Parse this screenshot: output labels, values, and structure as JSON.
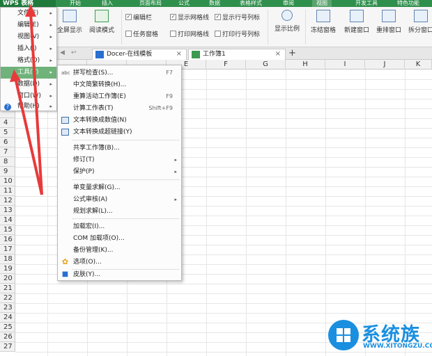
{
  "app": {
    "logo_label": "WPS 表格",
    "tabs": [
      "开始",
      "插入",
      "页面布局",
      "公式",
      "数据",
      "表格样式",
      "审阅",
      "视图",
      "开发工具",
      "特色功能"
    ],
    "active_tab": "视图"
  },
  "ribbon": {
    "fullscreen": "全屏显示",
    "reading_mode": "阅读模式",
    "check_edit_bar": "编辑栏",
    "check_task_pane": "任务窗格",
    "check_show_grid": "显示网格线",
    "check_print_grid": "打印网格线",
    "check_show_headers": "显示行号列标",
    "check_print_headers": "打印行号列标",
    "zoom": "显示比例",
    "freeze": "冻结窗格",
    "new_window": "新建窗口",
    "arrange": "重排窗口",
    "split": "拆分窗口"
  },
  "tabs_bar": {
    "nav_back": "◀",
    "nav_forward": "↩",
    "docer_tab": "Docer-在线模板",
    "workbook_tab": "工作簿1",
    "close": "×",
    "new": "+"
  },
  "grid": {
    "columns": [
      "E",
      "F",
      "G",
      "H",
      "I",
      "J",
      "K"
    ],
    "rows": [
      "4",
      "5",
      "6",
      "7",
      "8",
      "9",
      "10",
      "11",
      "12",
      "13",
      "14",
      "15",
      "16",
      "17",
      "18",
      "19",
      "20",
      "21",
      "22",
      "23",
      "24",
      "25",
      "26",
      "27"
    ]
  },
  "main_menu": {
    "items": [
      {
        "label": "文件(F)",
        "arrow": "▸"
      },
      {
        "label": "编辑(E)",
        "arrow": "▸"
      },
      {
        "label": "视图(V)",
        "arrow": "▸"
      },
      {
        "label": "插入(I)",
        "arrow": "▸"
      },
      {
        "label": "格式(O)",
        "arrow": "▸"
      },
      {
        "label": "工具(T)",
        "arrow": "▸"
      },
      {
        "label": "数据(D)",
        "arrow": "▸"
      },
      {
        "label": "窗口(W)",
        "arrow": "▸"
      },
      {
        "label": "帮助(H)",
        "arrow": "▸"
      }
    ]
  },
  "tools_menu": {
    "items": [
      {
        "label": "拼写检查(S)...",
        "shortcut": "F7",
        "icon": "abc"
      },
      {
        "label": "中文简繁转换(H)...",
        "shortcut": "",
        "icon": ""
      },
      {
        "label": "重算活动工作簿(E)",
        "shortcut": "F9",
        "icon": ""
      },
      {
        "label": "计算工作表(T)",
        "shortcut": "Shift+F9",
        "icon": ""
      },
      {
        "label": "文本转换成数值(N)",
        "shortcut": "",
        "icon": "text-convert-icon"
      },
      {
        "label": "文本转换成超链接(Y)",
        "shortcut": "",
        "icon": "hyperlink-icon"
      },
      {
        "label": "共享工作簿(B)...",
        "shortcut": "",
        "icon": ""
      },
      {
        "label": "修订(T)",
        "shortcut": "",
        "icon": "",
        "arrow": "▸"
      },
      {
        "label": "保护(P)",
        "shortcut": "",
        "icon": "",
        "arrow": "▸"
      },
      {
        "label": "单变量求解(G)...",
        "shortcut": "",
        "icon": ""
      },
      {
        "label": "公式审核(A)",
        "shortcut": "",
        "icon": "",
        "arrow": "▸"
      },
      {
        "label": "规划求解(L)...",
        "shortcut": "",
        "icon": ""
      },
      {
        "label": "加载宏(I)...",
        "shortcut": "",
        "icon": ""
      },
      {
        "label": "COM 加载项(O)...",
        "shortcut": "",
        "icon": ""
      },
      {
        "label": "备份管理(K)...",
        "shortcut": "",
        "icon": ""
      },
      {
        "label": "选项(O)...",
        "shortcut": "",
        "icon": "gear-icon"
      },
      {
        "label": "皮肤(Y)...",
        "shortcut": "",
        "icon": "shirt-icon"
      }
    ]
  },
  "watermark": {
    "title": "系统族",
    "url": "WWW.XITONGZU.COM"
  },
  "colors": {
    "brand_green": "#2f8f4c",
    "menu_highlight": "#6fb27a",
    "arrow_red": "#e83a3a",
    "watermark_blue": "#1a8fe0"
  }
}
